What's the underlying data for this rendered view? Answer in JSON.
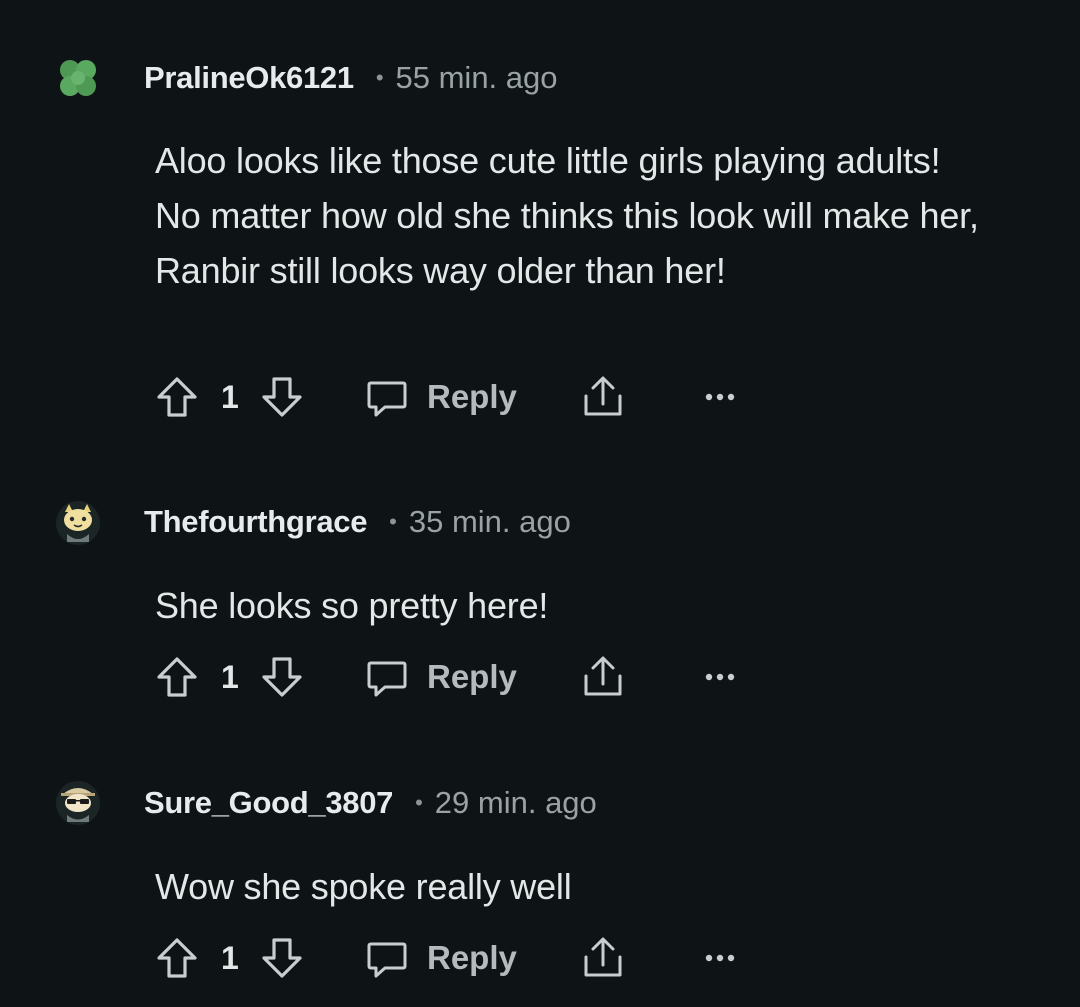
{
  "comments": [
    {
      "username": "PralineOk6121",
      "time": "55 min. ago",
      "body": "Aloo looks like those cute little girls playing adults! No matter how old she thinks this look will make her, Ranbir still looks way older than her!",
      "votes": "1",
      "reply_label": "Reply",
      "avatar": "clover-avatar"
    },
    {
      "username": "Thefourthgrace",
      "time": "35 min. ago",
      "body": "She looks so pretty here!",
      "votes": "1",
      "reply_label": "Reply",
      "avatar": "snoo-cat-avatar"
    },
    {
      "username": "Sure_Good_3807",
      "time": "29 min. ago",
      "body": "Wow she spoke really well",
      "votes": "1",
      "reply_label": "Reply",
      "avatar": "snoo-sunglasses-avatar"
    }
  ],
  "icons": {
    "upvote": "arrow-up-icon",
    "downvote": "arrow-down-icon",
    "reply": "speech-bubble-icon",
    "share": "share-icon",
    "more": "ellipsis-icon"
  },
  "colors": {
    "background": "#0e1415",
    "text": "#e4e7e8",
    "muted": "#9aa2a5",
    "icon": "#c9cdcf"
  }
}
